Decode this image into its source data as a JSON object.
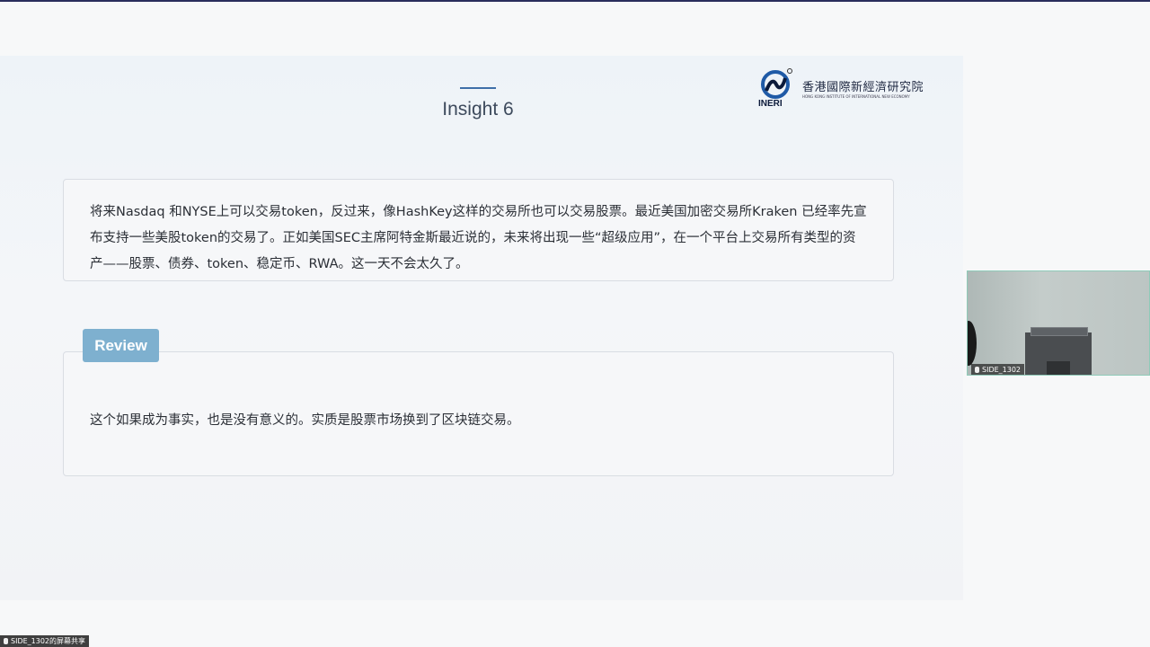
{
  "slide": {
    "title": "Insight 6",
    "logo": {
      "name_cn": "香港國際新經濟研究院",
      "abbr": "INERI",
      "name_en": "HONG KONG INSTITUTE OF INTERNATIONAL NEW ECONOMY"
    },
    "insight_text": "将来Nasdaq 和NYSE上可以交易token，反过来，像HashKey这样的交易所也可以交易股票。最近美国加密交易所Kraken 已经率先宣布支持一些美股token的交易了。正如美国SEC主席阿特金斯最近说的，未来将出现一些“超级应用”，在一个平台上交易所有类型的资产——股票、债券、token、稳定币、RWA。这一天不会太久了。",
    "review_label": "Review",
    "review_text": "这个如果成为事实，也是没有意义的。实质是股票市场换到了区块链交易。"
  },
  "video": {
    "participant_label": "SIDE_1302",
    "bottom_label": "SIDE_1302的屏幕共享"
  },
  "colors": {
    "accent": "#3f6fa8",
    "review_tag": "#7eb0cf",
    "top_rule": "#2a2d5c"
  }
}
